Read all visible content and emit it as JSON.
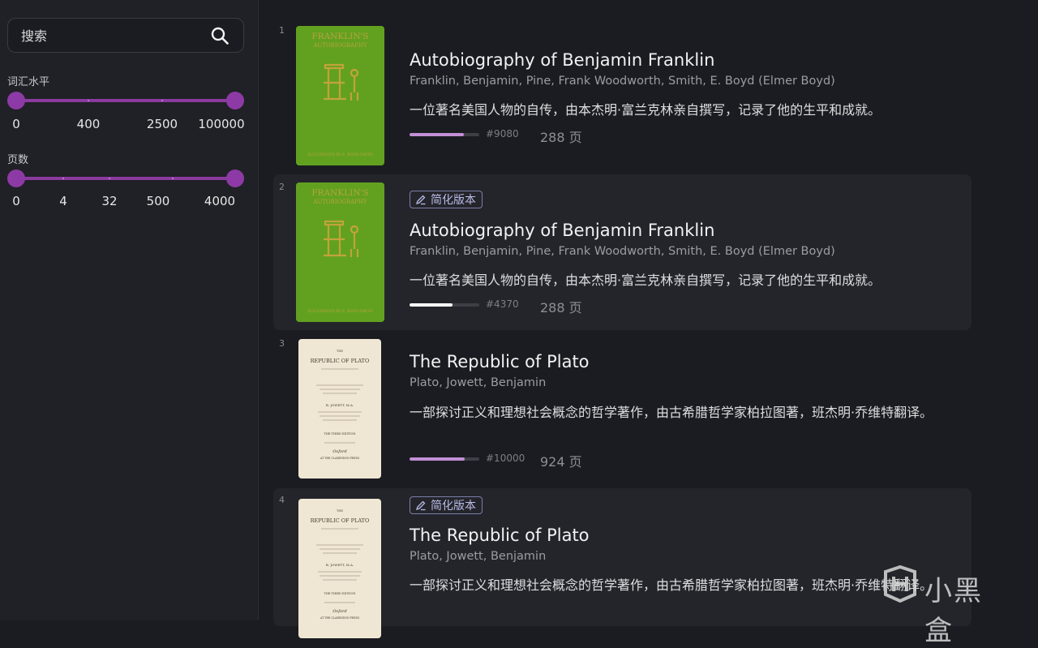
{
  "sidebar": {
    "search": {
      "placeholder": "搜索",
      "value": ""
    },
    "vocab": {
      "label": "词汇水平",
      "marks": [
        "0",
        "400",
        "2500",
        "100000"
      ],
      "range_min": "0",
      "range_max": "100000"
    },
    "pages": {
      "label": "页数",
      "marks": [
        "0",
        "4",
        "32",
        "500",
        "4000"
      ],
      "range_min": "0",
      "range_max": "4000"
    }
  },
  "colors": {
    "accent": "#8e3aa6",
    "progress_purple": "#c28fd6",
    "progress_white": "#ffffff",
    "badge": "#b9bbe6"
  },
  "books": [
    {
      "rank": "1",
      "simplified": false,
      "title": "Autobiography of Benjamin Franklin",
      "author": "Franklin, Benjamin, Pine, Frank Woodworth, Smith, E. Boyd (Elmer Boyd)",
      "desc": "一位著名美国人物的自传，由本杰明·富兰克林亲自撰写，记录了他的生平和成就。",
      "progress": 0.78,
      "progress_color": "#c28fd6",
      "rankno": "#9080",
      "pages": "288 页",
      "cover": "green"
    },
    {
      "rank": "2",
      "simplified": true,
      "badge": "简化版本",
      "title": "Autobiography of Benjamin Franklin",
      "author": "Franklin, Benjamin, Pine, Frank Woodworth, Smith, E. Boyd (Elmer Boyd)",
      "desc": "一位著名美国人物的自传，由本杰明·富兰克林亲自撰写，记录了他的生平和成就。",
      "progress": 0.62,
      "progress_color": "#ffffff",
      "rankno": "#4370",
      "pages": "288 页",
      "cover": "green"
    },
    {
      "rank": "3",
      "simplified": false,
      "title": "The Republic of Plato",
      "author": "Plato, Jowett, Benjamin",
      "desc": "一部探讨正义和理想社会概念的哲学著作，由古希腊哲学家柏拉图著，班杰明·乔维特翻译。",
      "progress": 0.79,
      "progress_color": "#c28fd6",
      "rankno": "#10000",
      "pages": "924 页",
      "cover": "paper"
    },
    {
      "rank": "4",
      "simplified": true,
      "badge": "简化版本",
      "title": "The Republic of Plato",
      "author": "Plato, Jowett, Benjamin",
      "desc": "一部探讨正义和理想社会概念的哲学著作，由古希腊哲学家柏拉图著，班杰明·乔维特翻译。",
      "cover": "paper"
    }
  ],
  "covers": {
    "franklin_title": "FRANKLIN'S",
    "franklin_subtitle": "AUTOBIOGRAPHY",
    "franklin_footer": "ILLUSTRATED BY E. BOYD SMITH",
    "plato_the": "THE",
    "plato_title": "REPUBLIC OF PLATO",
    "plato_by": "B. JOWETT, M.A.",
    "plato_edition": "THE THIRD EDITION",
    "plato_place": "Oxford",
    "plato_press": "AT THE CLARENDON PRESS"
  },
  "watermark": {
    "text": "小黑盒",
    "icon": "heybox-logo-icon"
  }
}
